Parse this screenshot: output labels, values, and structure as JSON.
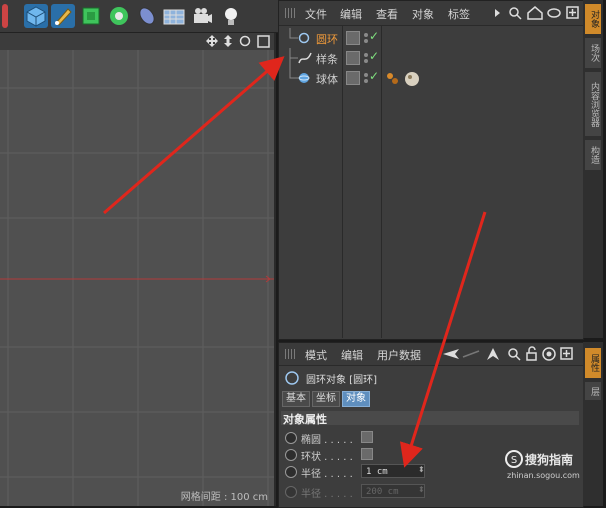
{
  "toolbar": {
    "icons": [
      "cube-icon",
      "pen-icon",
      "subdivision-icon",
      "cloner-icon",
      "deformer-icon",
      "floor-icon",
      "camera-icon",
      "light-icon"
    ]
  },
  "viewport": {
    "grid_spacing": "网格间距 : 100 cm",
    "header_icons": [
      "move-view-icon",
      "pan-view-icon",
      "rotate-view-icon",
      "layout-icon"
    ]
  },
  "object_manager": {
    "menu": [
      "文件",
      "编辑",
      "查看",
      "对象",
      "标签"
    ],
    "objects": [
      {
        "name": "圆环"
      },
      {
        "name": "样条"
      },
      {
        "name": "球体"
      }
    ]
  },
  "side_tabs_top": [
    "对象",
    "场次",
    "内容浏览器",
    "构造"
  ],
  "side_tabs_bottom": [
    "属性",
    "层"
  ],
  "attribute_manager": {
    "menu": [
      "模式",
      "编辑",
      "用户数据"
    ],
    "object_title": "圆环对象 [圆环]",
    "tabs": [
      "基本",
      "坐标",
      "对象"
    ],
    "active_tab": "对象",
    "section": "对象属性",
    "props": [
      {
        "label": "椭圆 . . . . ."
      },
      {
        "label": "环状 . . . . ."
      },
      {
        "label": "半径 . . . . .",
        "value": "1 cm"
      },
      {
        "label": "半径 . . . . .",
        "value": "200 cm"
      }
    ]
  },
  "watermark": {
    "brand": "搜狗指南",
    "url": "zhinan.sogou.com"
  },
  "colors": {
    "accent_red": "#e0261c",
    "check_green": "#7fe07f",
    "active_tab": "#5f8fbf"
  }
}
